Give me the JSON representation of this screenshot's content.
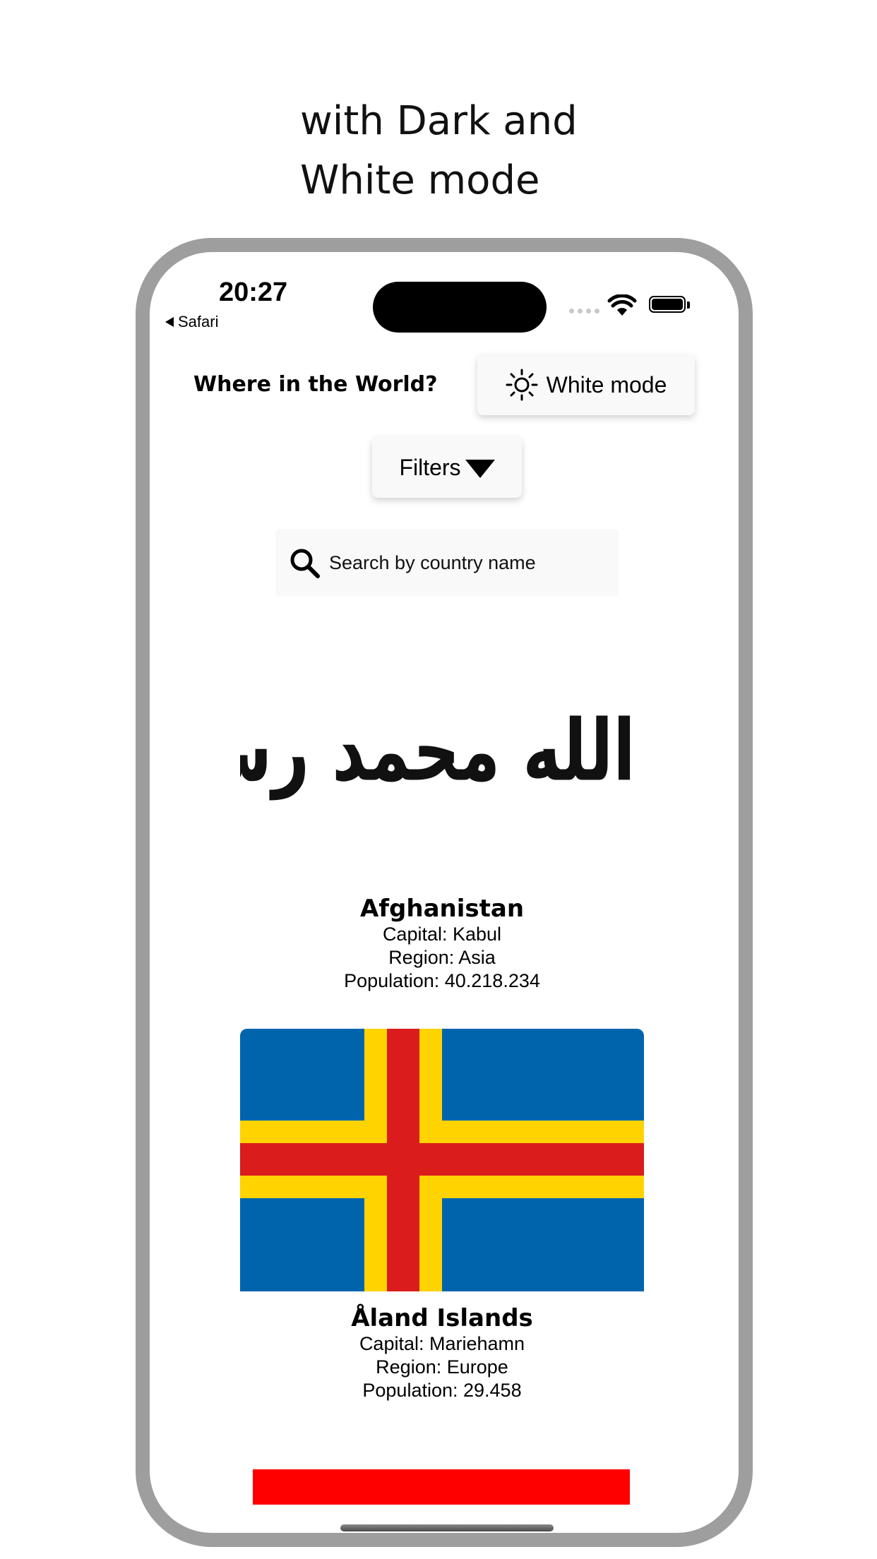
{
  "headline": {
    "line1": "with Dark and",
    "line2": "White mode"
  },
  "status_bar": {
    "time": "20:27",
    "back_label": "Safari"
  },
  "header": {
    "title": "Where in the World?",
    "mode_button_label": "White mode",
    "mode_icon": "sun-icon"
  },
  "filters": {
    "label": "Filters",
    "icon": "caret-down-icon"
  },
  "search": {
    "placeholder": "Search by country name",
    "icon": "search-icon"
  },
  "countries": [
    {
      "name": "Afghanistan",
      "capital": "Capital: Kabul",
      "region": "Region: Asia",
      "population": "Population: 40.218.234",
      "flag_text": "لا إله إلا الله محمد رسول الله"
    },
    {
      "name": "Åland Islands",
      "capital": "Capital: Mariehamn",
      "region": "Region: Europe",
      "population": "Population: 29.458",
      "flag_colors": {
        "field": "#0064ad",
        "cross_outer": "#ffd300",
        "cross_inner": "#da1c1c"
      }
    }
  ],
  "colors": {
    "phone_frame": "#9e9e9e",
    "button_bg": "#f9f9f9",
    "next_flag": "#ff0000"
  }
}
